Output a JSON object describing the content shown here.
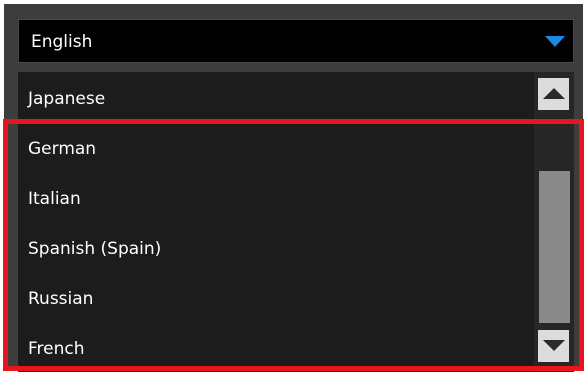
{
  "select": {
    "current_value": "English"
  },
  "list": {
    "items": [
      {
        "label": "Japanese"
      },
      {
        "label": "German"
      },
      {
        "label": "Italian"
      },
      {
        "label": "Spanish (Spain)"
      },
      {
        "label": "Russian"
      },
      {
        "label": "French"
      }
    ]
  },
  "icons": {
    "dropdown": "chevron-down-icon",
    "scroll_up": "arrow-up-icon",
    "scroll_down": "arrow-down-icon"
  },
  "colors": {
    "accent": "#1e88e5",
    "highlight": "#e8141e",
    "panel": "#3d3d3d",
    "list_bg": "#1c1c1c"
  }
}
